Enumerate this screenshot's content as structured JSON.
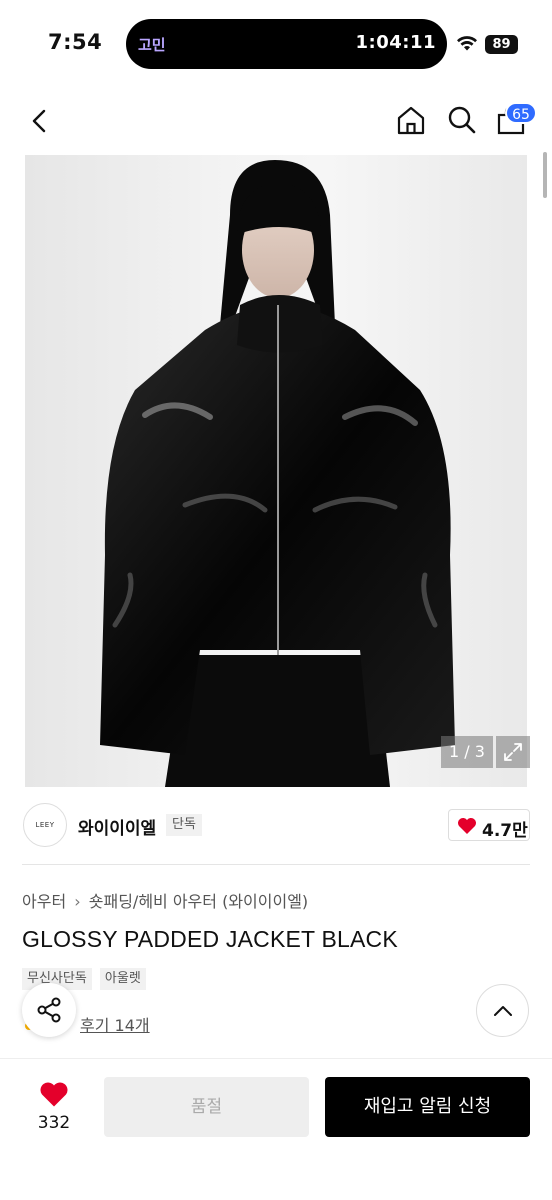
{
  "status_bar": {
    "time": "7:54",
    "island_app": "고민",
    "island_timer": "1:04:11",
    "battery": "89"
  },
  "nav": {
    "cart_count": "65"
  },
  "gallery": {
    "counter": "1 / 3"
  },
  "brand": {
    "logo_text": "LEEY",
    "name": "와이이이엘",
    "tag": "단독",
    "likes": "4.7만"
  },
  "product": {
    "breadcrumb": [
      "아우터",
      "숏패딩/헤비 아우터 (와이이이엘)"
    ],
    "breadcrumb_sep": "›",
    "title": "GLOSSY PADDED JACKET BLACK",
    "tags": [
      "무신사단독",
      "아울렛"
    ],
    "reviews": "후기 14개"
  },
  "bottom_bar": {
    "like_count": "332",
    "soldout_label": "품절",
    "restock_label": "재입고 알림 신청"
  },
  "colors": {
    "accent_blue": "#2f6bff",
    "heart_red": "#e4002b",
    "primary_black": "#000000"
  },
  "icons": {
    "back": "chevron-left-icon",
    "home": "home-icon",
    "search": "search-icon",
    "cart": "shopping-bag-icon",
    "expand": "expand-icon",
    "heart": "heart-icon",
    "share": "share-icon",
    "scroll_top": "chevron-up-icon"
  }
}
